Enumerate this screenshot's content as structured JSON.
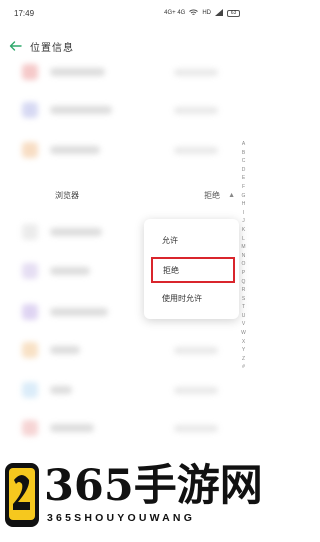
{
  "status_bar": {
    "time": "17:49",
    "network": "4G+ 4G",
    "hd_label": "HD",
    "battery": "63"
  },
  "header": {
    "title": "位置信息"
  },
  "browser_row": {
    "label": "浏览器",
    "value": "拒绝"
  },
  "popup_menu": {
    "items": [
      "允许",
      "拒绝",
      "使用时允许"
    ],
    "selected_index": 1
  },
  "alpha_index": [
    "A",
    "B",
    "C",
    "D",
    "E",
    "F",
    "G",
    "H",
    "I",
    "J",
    "K",
    "L",
    "M",
    "N",
    "O",
    "P",
    "Q",
    "R",
    "S",
    "T",
    "U",
    "V",
    "W",
    "X",
    "Y",
    "Z",
    "#"
  ],
  "watermark": {
    "main_text": "365手游网",
    "sub_text": "365SHOUYOUWANG"
  },
  "colors": {
    "accent_green": "#2ea86b",
    "highlight_red": "#d9252c"
  }
}
